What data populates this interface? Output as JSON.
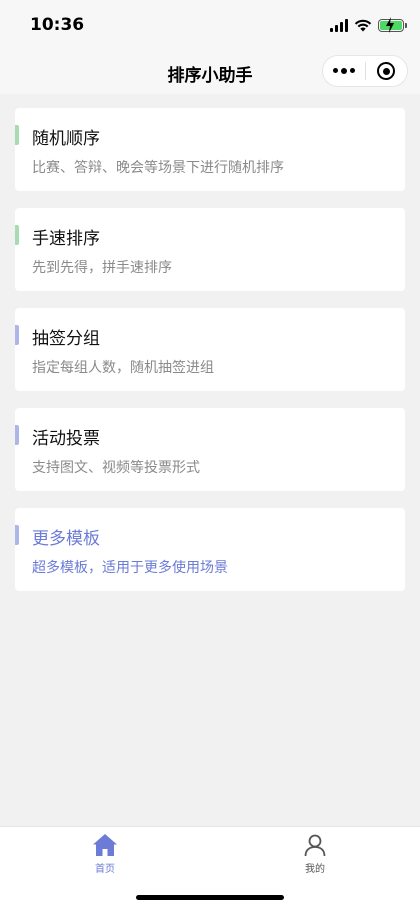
{
  "status_bar": {
    "time": "10:36",
    "signal_icon": "signal-icon",
    "wifi_icon": "wifi-icon",
    "battery_icon": "battery-charging-icon"
  },
  "nav": {
    "title": "排序小助手",
    "more_icon": "more-dots-icon",
    "close_icon": "mini-program-close-icon"
  },
  "cards": [
    {
      "title": "随机顺序",
      "desc": "比赛、答辩、晚会等场景下进行随机排序",
      "accent_color": "#a8dcb0",
      "title_color": "#111111",
      "desc_color": "#8a8a8a"
    },
    {
      "title": "手速排序",
      "desc": "先到先得，拼手速排序",
      "accent_color": "#a8dcb0",
      "title_color": "#111111",
      "desc_color": "#8a8a8a"
    },
    {
      "title": "抽签分组",
      "desc": "指定每组人数，随机抽签进组",
      "accent_color": "#aeb6e8",
      "title_color": "#111111",
      "desc_color": "#8a8a8a"
    },
    {
      "title": "活动投票",
      "desc": "支持图文、视频等投票形式",
      "accent_color": "#aeb6e8",
      "title_color": "#111111",
      "desc_color": "#8a8a8a"
    },
    {
      "title": "更多模板",
      "desc": "超多模板，适用于更多使用场景",
      "accent_color": "#aeb6e8",
      "title_color": "#6b7bd6",
      "desc_color": "#6b7bd6"
    }
  ],
  "tab_bar": {
    "tabs": [
      {
        "label": "首页",
        "icon": "home-icon",
        "active": true,
        "color": "#6b7bd6"
      },
      {
        "label": "我的",
        "icon": "user-icon",
        "active": false,
        "color": "#555555"
      }
    ]
  },
  "colors": {
    "accent": "#6b7bd6",
    "background": "#f1f1f1"
  }
}
